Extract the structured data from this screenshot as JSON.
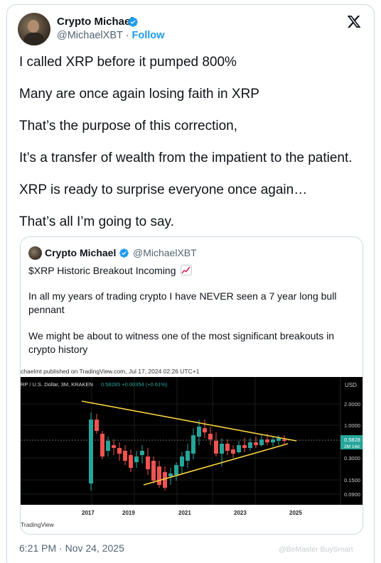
{
  "author": {
    "name": "Crypto Michael",
    "handle": "@MichaelXBT",
    "separator": "·",
    "follow_label": "Follow"
  },
  "icons": {
    "verified": "verified-badge-icon",
    "platform": "x-logo-icon",
    "emoji": "chart-increasing-icon"
  },
  "tweet_lines": [
    "I called XRP before it pumped 800%",
    "Many are once again losing faith in XRP",
    "That’s the purpose of this correction,",
    "It’s a transfer of wealth from the impatient to the patient.",
    "XRP is ready to surprise everyone once again…",
    "That’s all I’m going to say."
  ],
  "quoted": {
    "name": "Crypto Michael",
    "handle": "@MichaelXBT",
    "title": "$XRP Historic Breakout Incoming",
    "para1_line1": "In all my years of trading crypto I have NEVER seen a 7 year long bull",
    "para1_line2": "pennant",
    "para2_line1": "We might be about to witness one of the most significant breakouts in",
    "para2_line2": "crypto history"
  },
  "chart": {
    "caption": "chaelmt published on TradingView.com, Jul 17, 2024 02:26 UTC+1",
    "symbol": "RP / U.S. Dollar, 3M, KRAKEN",
    "price_info": "0.58285  +0.00354 (+0.61%)",
    "currency": "USD",
    "price_tag": "0.5828",
    "price_tag_sub": "2M 14d",
    "footer": "TradingView"
  },
  "chart_data": {
    "type": "candlestick",
    "x_ticks": [
      "2017",
      "2019",
      "2021",
      "2023",
      "2025"
    ],
    "y_ticks": [
      "2.0000",
      "1.0000",
      "0.3000",
      "0.1500",
      "0.0900"
    ],
    "current_price": 0.58285,
    "colors": {
      "up": "#26a69a",
      "down": "#ef5350",
      "trendline": "#f7d23e"
    }
  },
  "timestamp": "6:21 PM · Nov 24, 2025",
  "watermark": "@BeMaster BuySmart"
}
